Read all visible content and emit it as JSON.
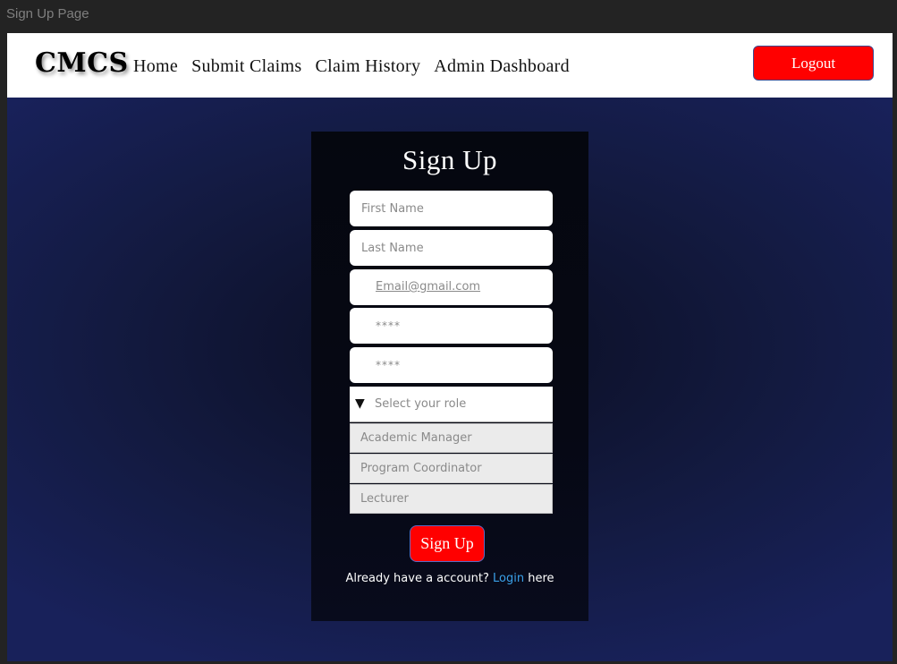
{
  "window": {
    "title": "Sign Up Page"
  },
  "navbar": {
    "brand": "CMCS",
    "links": [
      {
        "label": "Home"
      },
      {
        "label": "Submit Claims"
      },
      {
        "label": "Claim History"
      },
      {
        "label": "Admin Dashboard"
      }
    ],
    "logout_label": "Logout"
  },
  "form": {
    "title": "Sign Up",
    "first_name_placeholder": "First Name",
    "last_name_placeholder": "Last Name",
    "email_value": "Email@gmail.com",
    "password_value": "****",
    "confirm_password_value": "****",
    "role_placeholder": "Select your role",
    "role_arrow": "▼",
    "role_options": [
      {
        "label": "Academic Manager"
      },
      {
        "label": "Program Coordinator"
      },
      {
        "label": "Lecturer"
      }
    ],
    "submit_label": "Sign Up",
    "login_prompt_before": "Already have a account?",
    "login_link": "Login",
    "login_prompt_after": "here"
  },
  "colors": {
    "accent_red": "#ff0000",
    "link_blue": "#3aa0e8",
    "background_navy": "#18215a",
    "card_dark": "#05070f"
  }
}
